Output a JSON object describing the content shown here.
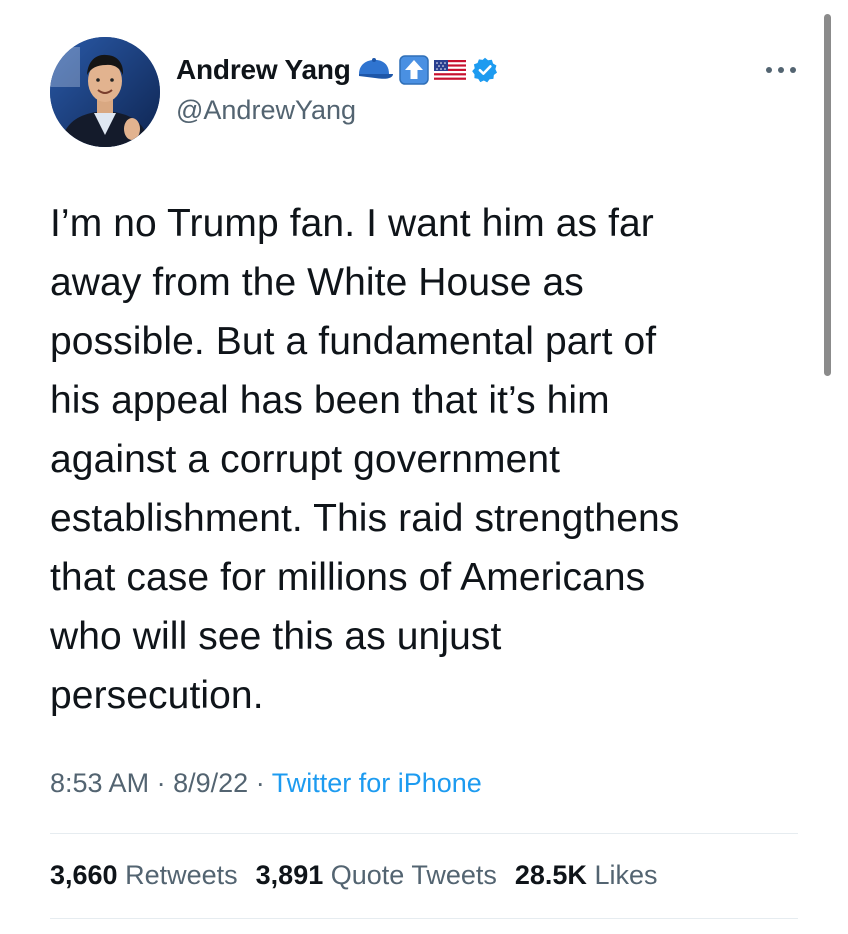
{
  "author": {
    "display_name": "Andrew Yang",
    "name_emojis": [
      "blue-cap-icon",
      "up-arrow-emoji-icon",
      "us-flag-icon"
    ],
    "verified": true,
    "handle": "@AndrewYang",
    "avatar": "andrew-yang-profile-photo"
  },
  "tweet": {
    "text": "I’m no Trump fan. I want him as far\naway from the White House as\npossible. But a fundamental part of\nhis appeal has been that it’s him\nagainst a corrupt government\nestablishment. This raid strengthens\nthat case for millions of Americans\nwho will see this as unjust\npersecution.",
    "time": "8:53 AM",
    "separator": "·",
    "date": "8/9/22",
    "source": "Twitter for iPhone"
  },
  "stats": {
    "retweets_count": "3,660",
    "retweets_label": "Retweets",
    "quotes_count": "3,891",
    "quotes_label": "Quote Tweets",
    "likes_count": "28.5K",
    "likes_label": "Likes"
  },
  "colors": {
    "text_primary": "#0f1419",
    "text_secondary": "#536471",
    "accent": "#1d9bf0",
    "divider": "#e6ecf0"
  },
  "icons": {
    "more": "more-horizontal-icon",
    "verified": "verified-badge-icon"
  }
}
